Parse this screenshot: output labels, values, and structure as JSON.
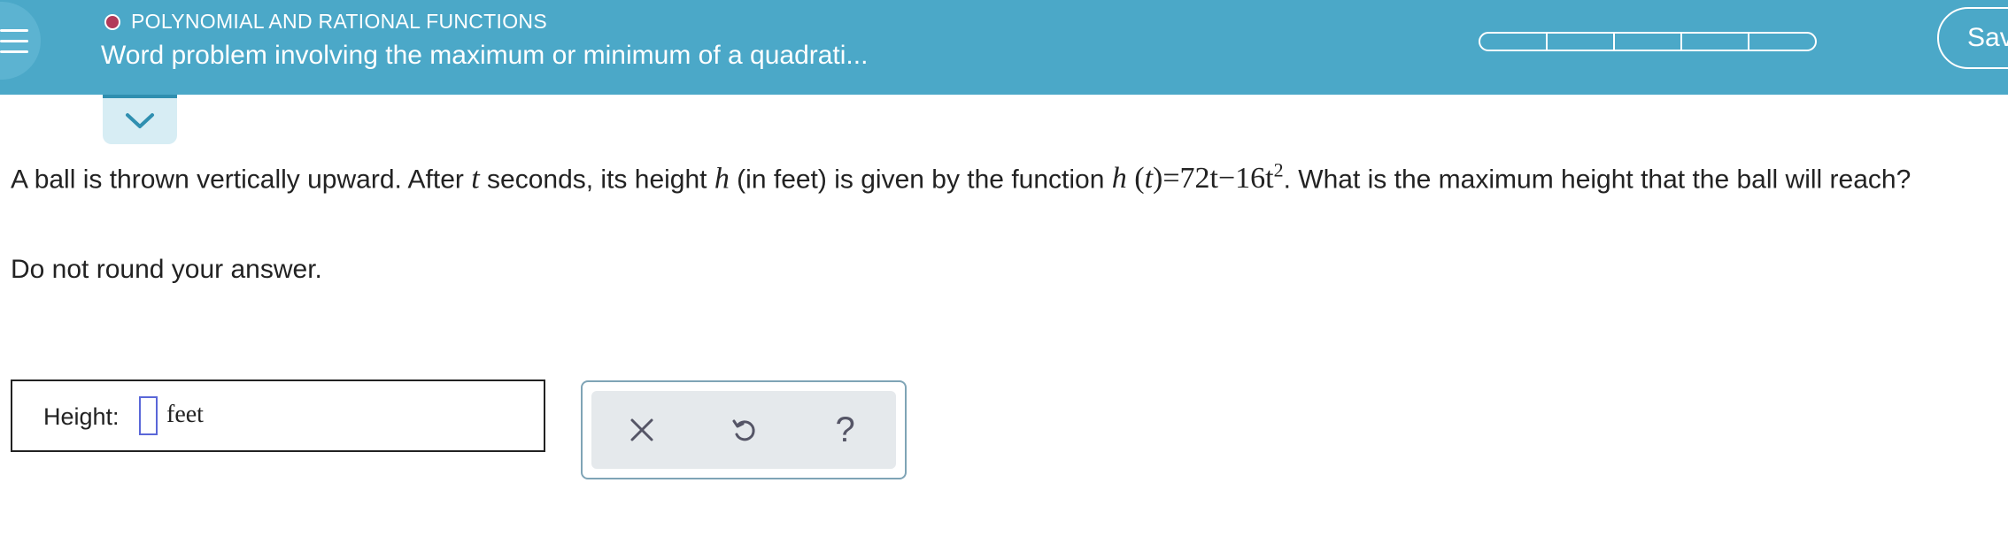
{
  "header": {
    "topic": "POLYNOMIAL AND RATIONAL FUNCTIONS",
    "title": "Word problem involving the maximum or minimum of a quadrati...",
    "save_label": "Sav",
    "progress_segments": 5,
    "colors": {
      "bar": "#4ba8c8",
      "topic_dot": "#b23a59"
    }
  },
  "question": {
    "part1": "A ball is thrown vertically upward. After ",
    "var_t": "t",
    "part2": " seconds, its height ",
    "var_h": "h",
    "part3": " (in feet) is given by the function ",
    "formula_h": "h",
    "formula_open": " (",
    "formula_t": "t",
    "formula_close": ")",
    "formula_rest": "=72t−16t",
    "formula_exp": "2",
    "part4": ". What is the maximum height that the ball will reach?",
    "instruction": "Do not round your answer."
  },
  "answer": {
    "label": "Height:",
    "value": "",
    "unit": "feet"
  },
  "tools": {
    "clear": "clear-icon",
    "undo": "undo-icon",
    "help": "help-icon",
    "help_glyph": "?"
  }
}
